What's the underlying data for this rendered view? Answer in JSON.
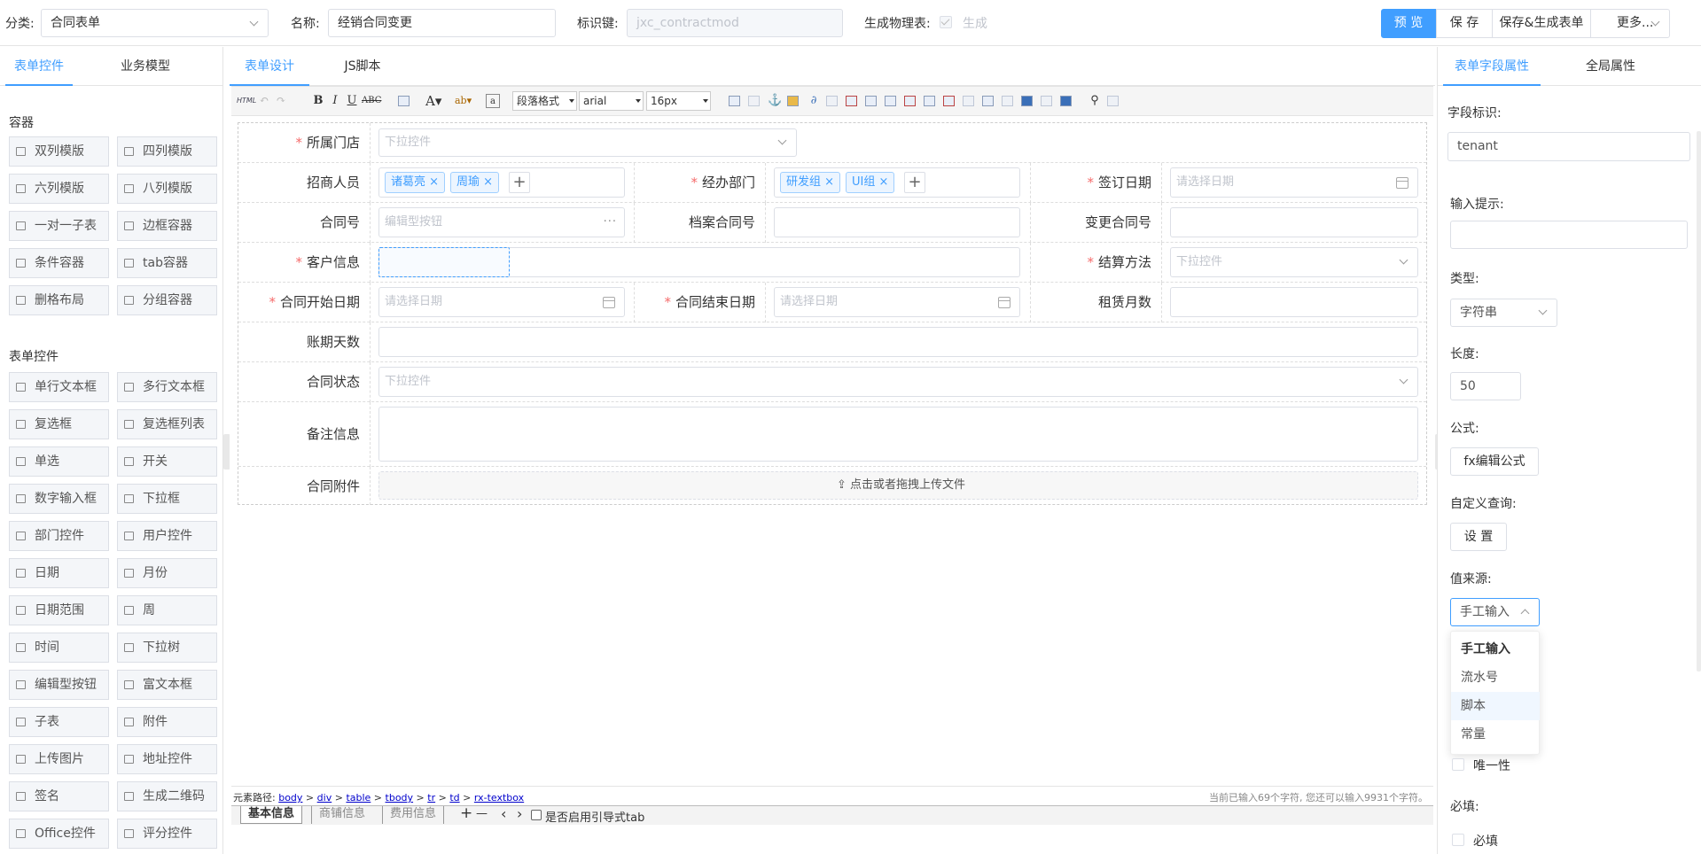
{
  "topbar": {
    "category_label": "分类:",
    "category_value": "合同表单",
    "name_label": "名称:",
    "name_value": "经销合同变更",
    "key_label": "标识键:",
    "key_value": "jxc_contractmod",
    "physical_label": "生成物理表:",
    "physical_check_label": "生成",
    "buttons": {
      "preview": "预 览",
      "save": "保 存",
      "save_gen": "保存&生成表单",
      "more": "更多..."
    }
  },
  "left": {
    "tabs": [
      "表单控件",
      "业务模型"
    ],
    "container_title": "容器",
    "containers": [
      "双列模版",
      "四列模版",
      "六列模版",
      "八列模版",
      "一对一子表",
      "边框容器",
      "条件容器",
      "tab容器",
      "删格布局",
      "分组容器"
    ],
    "controls_title": "表单控件",
    "controls": [
      "单行文本框",
      "多行文本框",
      "复选框",
      "复选框列表",
      "单选",
      "开关",
      "数字输入框",
      "下拉框",
      "部门控件",
      "用户控件",
      "日期",
      "月份",
      "日期范围",
      "周",
      "时间",
      "下拉树",
      "编辑型按钮",
      "富文本框",
      "子表",
      "附件",
      "上传图片",
      "地址控件",
      "签名",
      "生成二维码",
      "Office控件",
      "评分控件"
    ]
  },
  "center": {
    "tabs": [
      "表单设计",
      "JS脚本"
    ],
    "toolbar": {
      "html_label": "HTML",
      "paragraph_format": "段落格式",
      "font": "arial",
      "size": "16px"
    },
    "form": {
      "store": {
        "label": "所属门店",
        "placeholder": "下拉控件"
      },
      "recruiter": {
        "label": "招商人员",
        "tags": [
          "诸葛亮",
          "周瑜"
        ]
      },
      "dept": {
        "label": "经办部门",
        "tags": [
          "研发组",
          "UI组"
        ]
      },
      "sign_date": {
        "label": "签订日期",
        "placeholder": "请选择日期"
      },
      "contract_no": {
        "label": "合同号",
        "placeholder": "编辑型按钮",
        "dots": "···"
      },
      "archive_no": {
        "label": "档案合同号"
      },
      "change_no": {
        "label": "变更合同号"
      },
      "customer": {
        "label": "客户信息"
      },
      "settle": {
        "label": "结算方法",
        "placeholder": "下拉控件"
      },
      "start_date": {
        "label": "合同开始日期",
        "placeholder": "请选择日期"
      },
      "end_date": {
        "label": "合同结束日期",
        "placeholder": "请选择日期"
      },
      "lease_months": {
        "label": "租赁月数"
      },
      "bill_days": {
        "label": "账期天数"
      },
      "status": {
        "label": "合同状态",
        "placeholder": "下拉控件"
      },
      "remark": {
        "label": "备注信息"
      },
      "attachment": {
        "label": "合同附件",
        "upload_text": "点击或者拖拽上传文件"
      }
    },
    "status": {
      "path_label": "元素路径:",
      "path": [
        "body",
        "div",
        "table",
        "tbody",
        "tr",
        "td",
        "rx-textbox"
      ],
      "count_text": "当前已输入69个字符, 您还可以输入9931个字符。"
    },
    "sheets": [
      "基本信息",
      "商铺信息",
      "费用信息"
    ],
    "sheet_ops": {
      "add": "+",
      "remove": "—",
      "prev": "‹",
      "next": "›",
      "guide_label": "是否启用引导式tab"
    }
  },
  "right": {
    "tabs": [
      "表单字段属性",
      "全局属性"
    ],
    "field_id_label": "字段标识:",
    "field_id_value": "tenant",
    "hint_label": "输入提示:",
    "type_label": "类型:",
    "type_value": "字符串",
    "length_label": "长度:",
    "length_value": "50",
    "formula_label": "公式:",
    "formula_button": "fx编辑公式",
    "query_label": "自定义查询:",
    "query_button": "设 置",
    "source_label": "值来源:",
    "source_value": "手工输入",
    "source_options": [
      "手工输入",
      "流水号",
      "脚本",
      "常量"
    ],
    "unique_label": "唯一性",
    "required_title": "必填:",
    "required_label": "必填"
  },
  "colors": {
    "accent": "#409eff",
    "required": "#f56c6c",
    "tag_bg": "#ecf5ff"
  }
}
